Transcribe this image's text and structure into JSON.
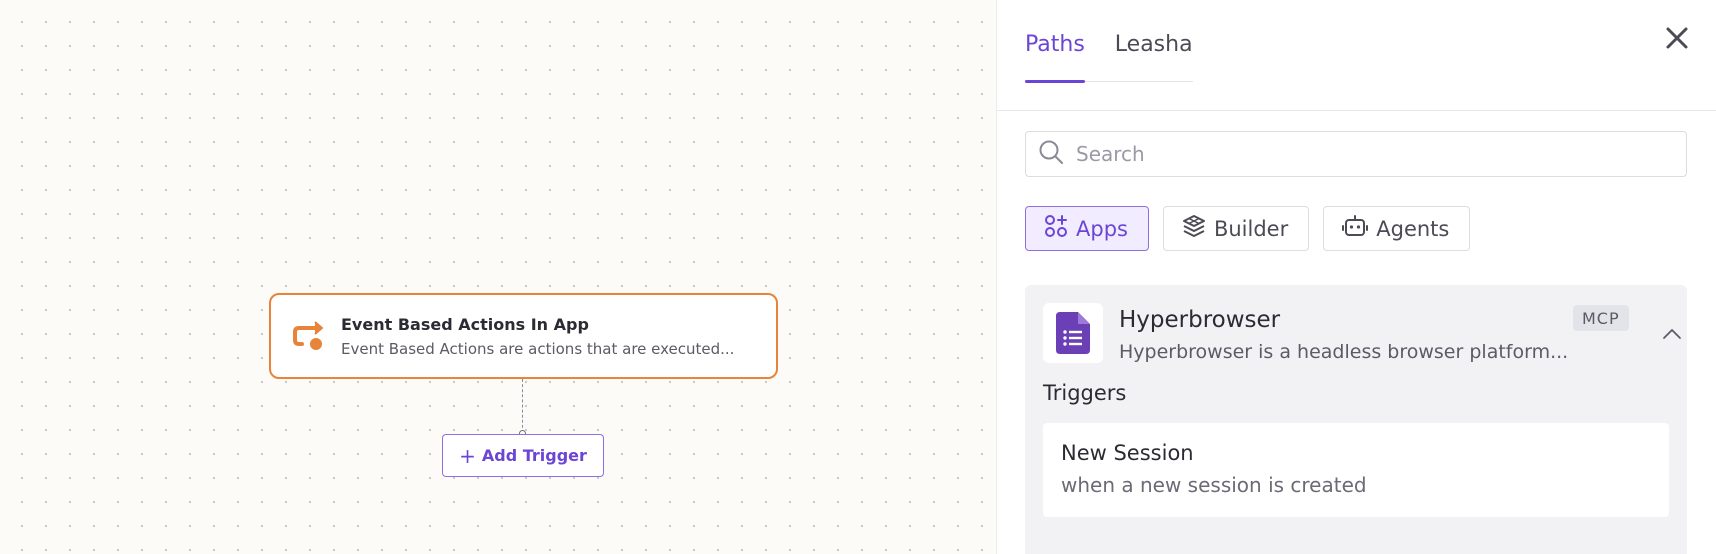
{
  "canvas": {
    "node": {
      "title": "Event Based Actions In App",
      "description": "Event Based Actions are actions that are executed...",
      "icon": "event-action-icon",
      "accent_color": "#e8833a"
    },
    "add_trigger_label": "Add Trigger"
  },
  "panel": {
    "tabs": [
      {
        "label": "Paths",
        "active": true
      },
      {
        "label": "Leasha",
        "active": false
      }
    ],
    "search": {
      "placeholder": "Search",
      "value": ""
    },
    "filters": [
      {
        "label": "Apps",
        "icon": "apps-icon",
        "active": true
      },
      {
        "label": "Builder",
        "icon": "builder-icon",
        "active": false
      },
      {
        "label": "Agents",
        "icon": "robot-icon",
        "active": false
      }
    ],
    "app": {
      "name": "Hyperbrowser",
      "description": "Hyperbrowser is a headless browser platform...",
      "badge": "MCP",
      "icon": "document-list-icon",
      "triggers_heading": "Triggers",
      "triggers": [
        {
          "name": "New Session",
          "description": "when a new session is created"
        }
      ]
    }
  },
  "colors": {
    "accent": "#6b46d6",
    "node_border": "#e8833a"
  }
}
